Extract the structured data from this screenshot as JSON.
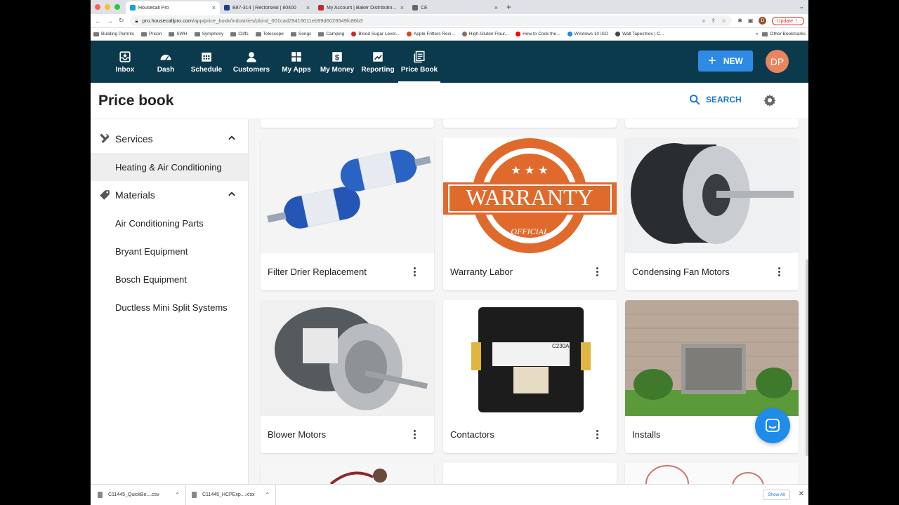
{
  "browser": {
    "tabs": [
      {
        "label": "Housecall Pro",
        "color": "#1aa0d8",
        "active": true
      },
      {
        "label": "B87-314 | Rectorseal | 80400",
        "color": "#1d3b8f",
        "active": false
      },
      {
        "label": "My Account | Baker Distributin...",
        "color": "#c62828",
        "active": false
      },
      {
        "label": "CE",
        "color": "#666666",
        "active": false
      }
    ],
    "url_host": "pro.housecallpro.com",
    "url_path": "/app/price_book/industries/pbind_001cad29416011eb99d6026549fc86b3",
    "avatar_initial": "D",
    "update_label": "Update",
    "bookmarks": [
      {
        "label": "Building Permits",
        "icon": "folder-icon"
      },
      {
        "label": "Prison",
        "icon": "folder-icon"
      },
      {
        "label": "SWH",
        "icon": "folder-icon"
      },
      {
        "label": "Symphony",
        "icon": "folder-icon"
      },
      {
        "label": "Cliffs",
        "icon": "folder-icon"
      },
      {
        "label": "Telescope",
        "icon": "folder-icon"
      },
      {
        "label": "Songs",
        "icon": "folder-icon"
      },
      {
        "label": "Camping",
        "icon": "folder-icon"
      },
      {
        "label": "Blood Sugar Level...",
        "icon": "drop-icon"
      },
      {
        "label": "Apple Fritters Reci...",
        "icon": "recipe-icon"
      },
      {
        "label": "High-Gluten Flour...",
        "icon": "flour-icon"
      },
      {
        "label": "How to Cook the...",
        "icon": "youtube-icon"
      },
      {
        "label": "Windows 10 ISO",
        "icon": "windows-icon"
      },
      {
        "label": "Wall Tapestries | C...",
        "icon": "shop-icon"
      }
    ],
    "other_bookmarks": "Other Bookmarks",
    "more_bookmarks": "»"
  },
  "nav": {
    "items": [
      {
        "label": "Inbox",
        "icon": "inbox-icon"
      },
      {
        "label": "Dash",
        "icon": "dashboard-icon"
      },
      {
        "label": "Schedule",
        "icon": "calendar-icon"
      },
      {
        "label": "Customers",
        "icon": "person-icon"
      },
      {
        "label": "My Apps",
        "icon": "apps-icon"
      },
      {
        "label": "My Money",
        "icon": "dollar-icon"
      },
      {
        "label": "Reporting",
        "icon": "trend-icon"
      },
      {
        "label": "Price Book",
        "icon": "book-icon"
      }
    ],
    "active": "Price Book",
    "new_label": "NEW",
    "user_initials": "DP",
    "colors": {
      "nav_bg": "#0c3a4d",
      "new_btn": "#2f8ae5",
      "avatar": "#e8845e"
    }
  },
  "page": {
    "title": "Price book",
    "search_label": "SEARCH"
  },
  "sidebar": {
    "sections": [
      {
        "label": "Services",
        "icon": "tools-icon",
        "items": [
          "Heating & Air Conditioning"
        ]
      },
      {
        "label": "Materials",
        "icon": "tag-icon",
        "items": [
          "Air Conditioning Parts",
          "Bryant Equipment",
          "Bosch Equipment",
          "Ductless Mini Split Systems"
        ]
      }
    ],
    "selected": "Heating & Air Conditioning"
  },
  "cards": [
    {
      "label": "Filter Drier Replacement",
      "image": "filter-drier-image"
    },
    {
      "label": "Warranty Labor",
      "image": "warranty-seal-image",
      "seal_text": "WARRANTY",
      "seal_sub": "OFFICIAL"
    },
    {
      "label": "Condensing Fan Motors",
      "image": "fan-motor-image"
    },
    {
      "label": "Blower Motors",
      "image": "blower-motor-image"
    },
    {
      "label": "Contactors",
      "image": "contactor-image",
      "contactor_model": "C230A"
    },
    {
      "label": "Installs",
      "image": "ac-unit-image"
    }
  ],
  "downloads": [
    {
      "name": "C11445_QuickBo....csv"
    },
    {
      "name": "C11445_HCPExp....xlsx"
    }
  ],
  "downloads_show_all": "Show All"
}
